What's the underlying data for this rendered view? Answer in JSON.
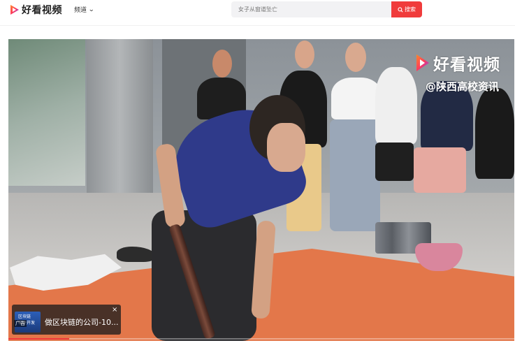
{
  "header": {
    "logo_text": "好看视频",
    "channel_label": "频道",
    "search_placeholder": "女子从窗道坠亡",
    "search_button_label": "搜索"
  },
  "video": {
    "watermark_title": "好看视频",
    "watermark_subtitle": "@陕西高校资讯",
    "progress": 0.12
  },
  "ad": {
    "thumb_line1": "区块链",
    "thumb_line2": "软件开发",
    "tag": "广告",
    "text": "做区块链的公司-10...",
    "close_icon": "close-icon"
  },
  "colors": {
    "accent": "#f03b3b",
    "logo_gradient_start": "#ff5a3c",
    "logo_gradient_end": "#7a3cff"
  }
}
